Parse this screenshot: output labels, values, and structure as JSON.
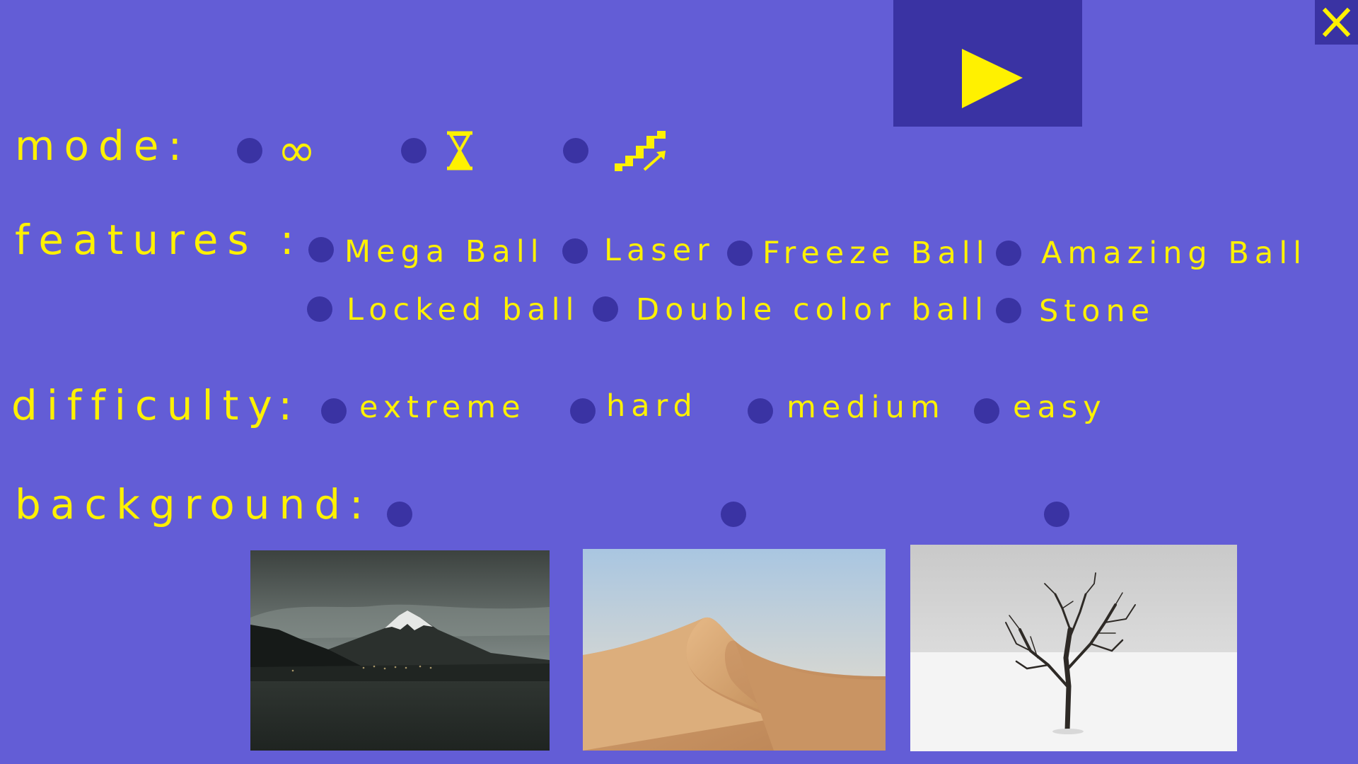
{
  "colors": {
    "background": "#635dd6",
    "panel": "#3a33a3",
    "accent": "#fff100"
  },
  "toolbar": {
    "play_icon": "play-icon",
    "close_icon": "close-icon"
  },
  "mode": {
    "label": "mode:",
    "options": [
      {
        "icon": "infinity-icon",
        "glyph": "∞"
      },
      {
        "icon": "hourglass-icon"
      },
      {
        "icon": "stairs-levels-icon"
      }
    ]
  },
  "features": {
    "label": "features :",
    "options": [
      {
        "label": "Mega Ball"
      },
      {
        "label": "Laser"
      },
      {
        "label": "Freeze Ball"
      },
      {
        "label": "Amazing Ball"
      },
      {
        "label": "Locked ball"
      },
      {
        "label": "Double color ball"
      },
      {
        "label": "Stone"
      }
    ]
  },
  "difficulty": {
    "label": "difficulty:",
    "options": [
      {
        "label": "extreme"
      },
      {
        "label": "hard"
      },
      {
        "label": "medium"
      },
      {
        "label": "easy"
      }
    ]
  },
  "background": {
    "label": "background:",
    "options": [
      {
        "scene": "mountain-lake"
      },
      {
        "scene": "desert-dune"
      },
      {
        "scene": "snow-tree"
      }
    ]
  }
}
